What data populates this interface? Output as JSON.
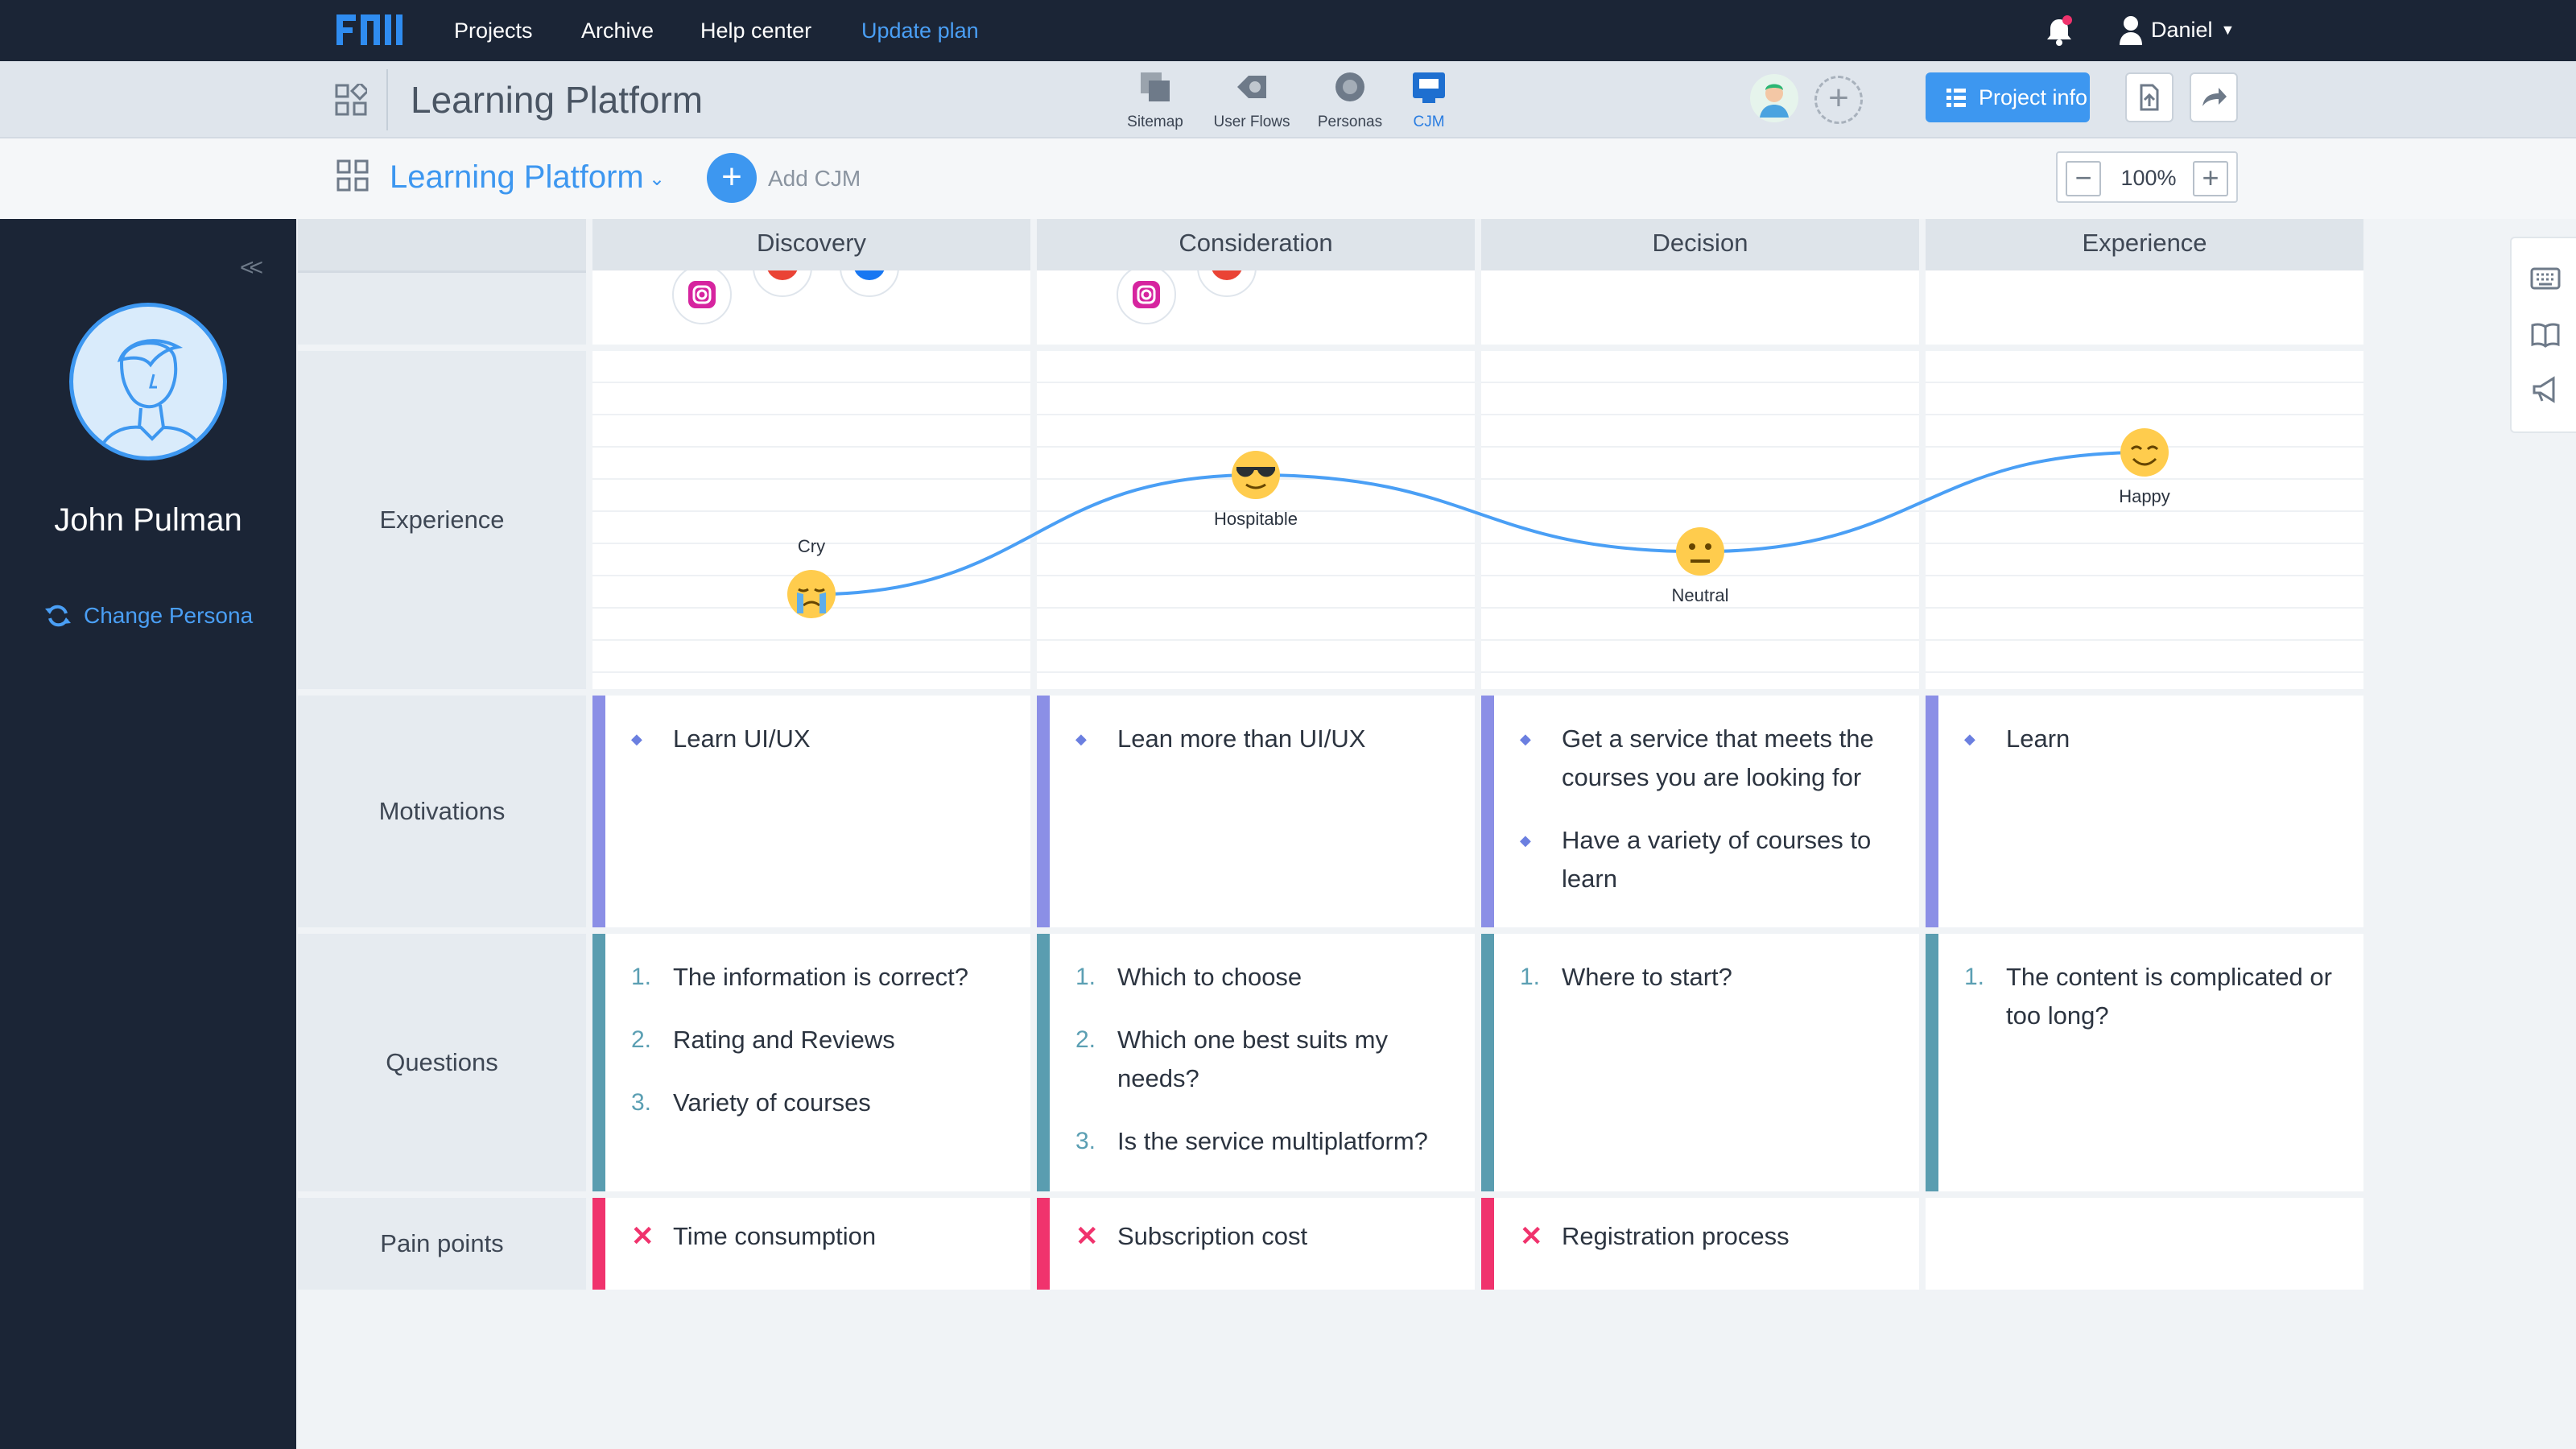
{
  "nav": {
    "projects": "Projects",
    "archive": "Archive",
    "help_center": "Help center",
    "update_plan": "Update plan",
    "user_name": "Daniel"
  },
  "project": {
    "title": "Learning Platform",
    "tabs": [
      {
        "label": "Sitemap",
        "icon": "sitemap-icon"
      },
      {
        "label": "User Flows",
        "icon": "user-flows-icon"
      },
      {
        "label": "Personas",
        "icon": "personas-icon"
      },
      {
        "label": "CJM",
        "icon": "cjm-icon",
        "active": true
      }
    ],
    "project_info_label": "Project info"
  },
  "cjm": {
    "title": "Learning Platform",
    "add_label": "Add CJM",
    "zoom": "100%"
  },
  "persona": {
    "name": "John Pulman",
    "change_label": "Change Persona"
  },
  "rows": {
    "experience": "Experience",
    "motivations": "Motivations",
    "questions": "Questions",
    "pain_points": "Pain points"
  },
  "stages": [
    {
      "name": "Discovery",
      "emotion": "Cry",
      "emotion_level": 0.17,
      "motivations": [
        "Learn UI/UX"
      ],
      "questions": [
        "The information is correct?",
        "Rating and Reviews",
        "Variety of courses"
      ],
      "pain_points": [
        "Time consumption"
      ]
    },
    {
      "name": "Consideration",
      "emotion": "Hospitable",
      "emotion_level": 0.7,
      "motivations": [
        "Lean more than UI/UX"
      ],
      "questions": [
        "Which to choose",
        "Which one best suits my needs?",
        "Is the service multiplatform?"
      ],
      "pain_points": [
        "Subscription cost"
      ]
    },
    {
      "name": "Decision",
      "emotion": "Neutral",
      "emotion_level": 0.36,
      "motivations": [
        "Get a service that meets the courses you are looking for",
        "Have a variety of courses to learn"
      ],
      "questions": [
        "Where to start?"
      ],
      "pain_points": [
        "Registration process"
      ]
    },
    {
      "name": "Experience",
      "emotion": "Happy",
      "emotion_level": 0.8,
      "motivations": [
        "Learn"
      ],
      "questions": [
        "The content is complicated or too long?"
      ],
      "pain_points": []
    }
  ],
  "colors": {
    "accent": "#3d97f0",
    "nav_bg": "#1b2536",
    "motivation_bar": "#8b8fe6",
    "question_bar": "#5a9db0",
    "pain_bar": "#f0336d",
    "curve": "#4a9ff5"
  }
}
